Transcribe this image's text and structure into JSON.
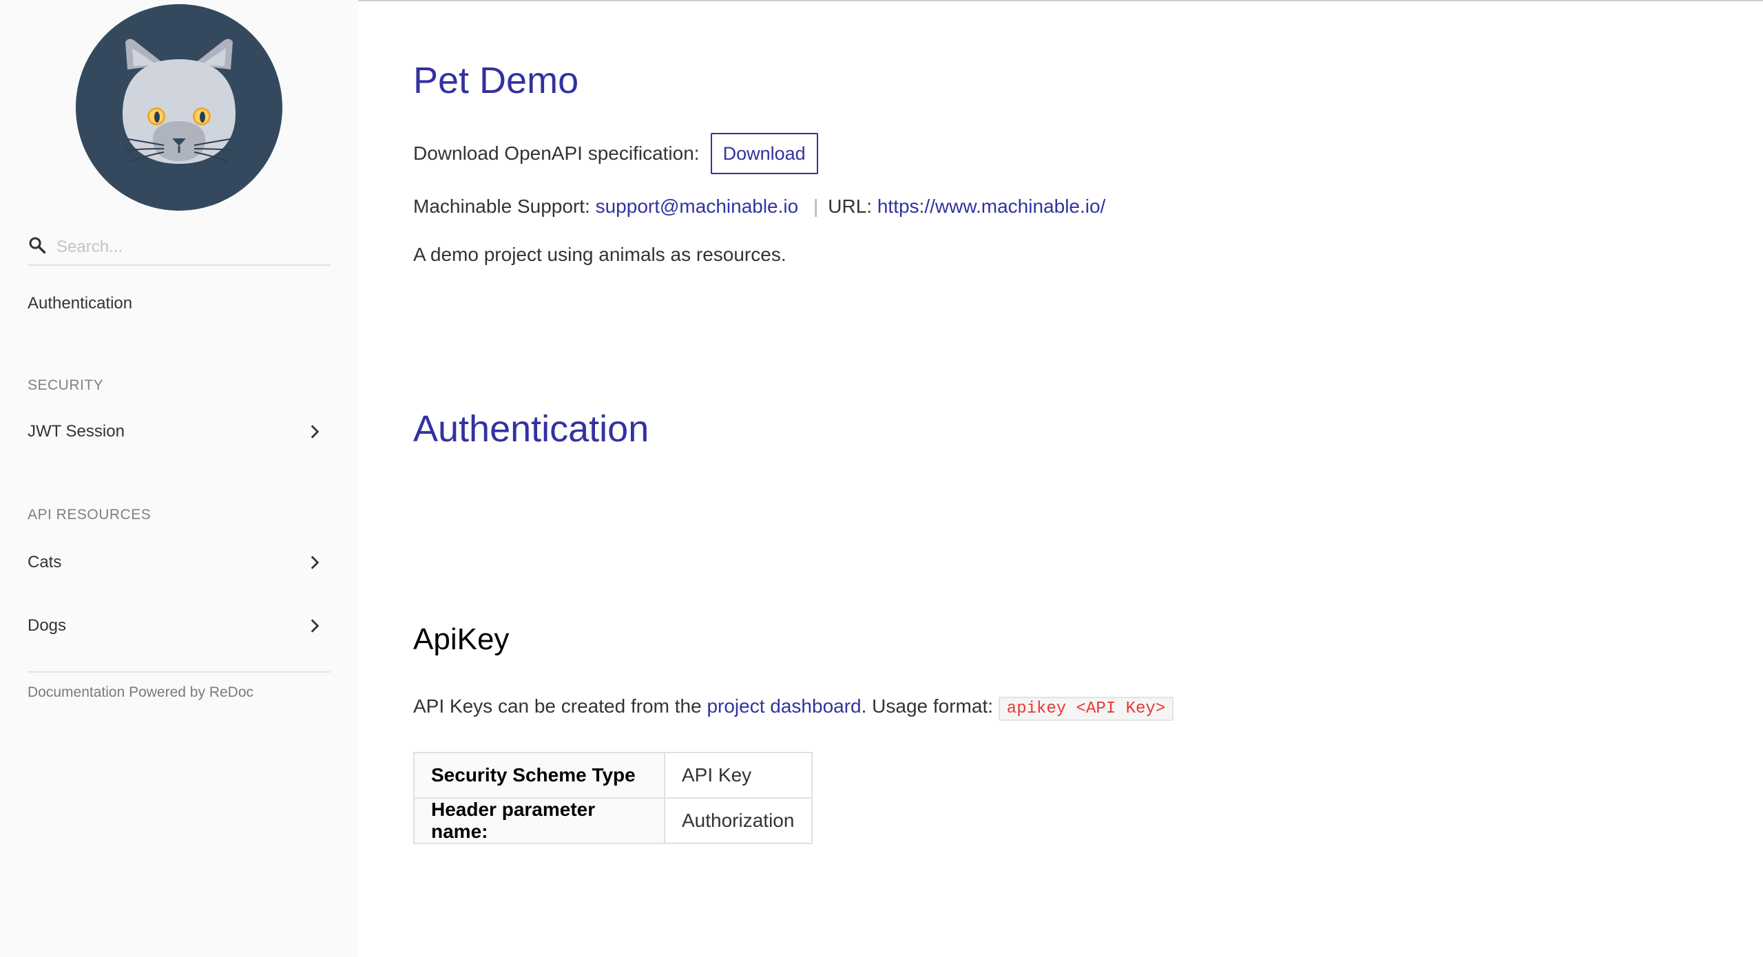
{
  "sidebar": {
    "logo_icon": "cat-avatar-icon",
    "search": {
      "placeholder": "Search...",
      "value": ""
    },
    "items": {
      "authentication": "Authentication"
    },
    "sections": [
      {
        "title": "SECURITY",
        "items": [
          "JWT Session"
        ]
      },
      {
        "title": "API RESOURCES",
        "items": [
          "Cats",
          "Dogs"
        ]
      }
    ],
    "powered_by": "Documentation Powered by ReDoc"
  },
  "main": {
    "title": "Pet Demo",
    "download_label": "Download OpenAPI specification:",
    "download_button": "Download",
    "support_label": "Machinable Support:",
    "support_email": "support@machinable.io",
    "separator": "|",
    "url_label": "URL:",
    "url": "https://www.machinable.io/",
    "description": "A demo project using animals as resources.",
    "auth_heading": "Authentication",
    "apikey_heading": "ApiKey",
    "apikey_text_before": "API Keys can be created from the",
    "apikey_link": "project dashboard",
    "apikey_text_after": ". Usage format:",
    "apikey_code": "apikey <API Key>",
    "security_table": [
      {
        "key": "Security Scheme Type",
        "value": "API Key"
      },
      {
        "key": "Header parameter name:",
        "value": "Authorization"
      }
    ]
  },
  "colors": {
    "accent": "#32329f",
    "code_red": "#e53935",
    "sidebar_bg": "#fafafa",
    "logo_bg": "#34495e"
  }
}
